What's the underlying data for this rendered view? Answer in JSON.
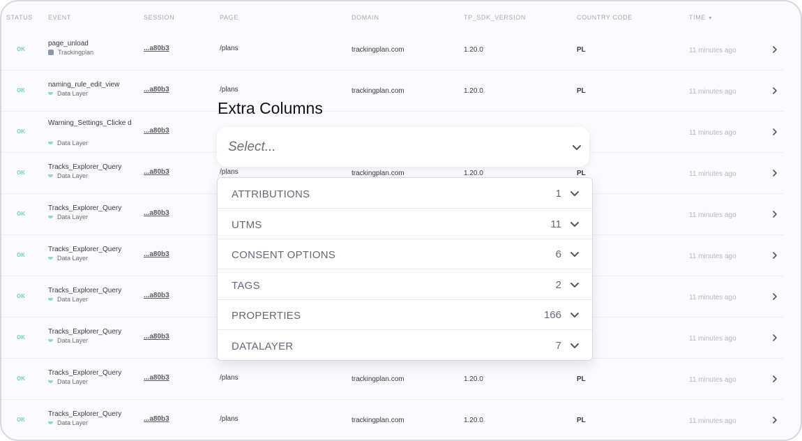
{
  "table": {
    "headers": {
      "status": "STATUS",
      "event": "EVENT",
      "session": "SESSION",
      "page": "PAGE",
      "domain": "DOMAIN",
      "sdk": "TP_SDK_VERSION",
      "country": "COUNTRY CODE",
      "time": "TIME"
    },
    "sort_indicator": "▼",
    "rows": [
      {
        "status": "OK",
        "event": "page_unload",
        "source": "Trackingplan",
        "source_icon": "trackingplan-icon",
        "session": "...a80b3",
        "page": "/plans",
        "domain": "trackingplan.com",
        "sdk": "1.20.0",
        "country": "PL",
        "time": "11 minutes ago"
      },
      {
        "status": "OK",
        "event": "naming_rule_edit_view",
        "source": "Data Layer",
        "source_icon": "datalayer-icon",
        "session": "...a80b3",
        "page": "/plans",
        "domain": "trackingplan.com",
        "sdk": "1.20.0",
        "country": "PL",
        "time": "11 minutes ago"
      },
      {
        "status": "OK",
        "event": "Warning_Settings_Clicke d",
        "source": "Data Layer",
        "source_icon": "datalayer-icon",
        "session": "...a80b3",
        "page": "",
        "domain": "",
        "sdk": "",
        "country": "",
        "time": "11 minutes ago"
      },
      {
        "status": "OK",
        "event": "Tracks_Explorer_Query",
        "source": "Data Layer",
        "source_icon": "datalayer-icon",
        "session": "...a80b3",
        "page": "/plans",
        "domain": "trackingplan.com",
        "sdk": "1.20.0",
        "country": "PL",
        "time": "11 minutes ago"
      },
      {
        "status": "OK",
        "event": "Tracks_Explorer_Query",
        "source": "Data Layer",
        "source_icon": "datalayer-icon",
        "session": "...a80b3",
        "page": "",
        "domain": "",
        "sdk": "",
        "country": "",
        "time": "11 minutes ago"
      },
      {
        "status": "OK",
        "event": "Tracks_Explorer_Query",
        "source": "Data Layer",
        "source_icon": "datalayer-icon",
        "session": "...a80b3",
        "page": "",
        "domain": "",
        "sdk": "",
        "country": "",
        "time": "11 minutes ago"
      },
      {
        "status": "OK",
        "event": "Tracks_Explorer_Query",
        "source": "Data Layer",
        "source_icon": "datalayer-icon",
        "session": "...a80b3",
        "page": "",
        "domain": "",
        "sdk": "",
        "country": "",
        "time": "11 minutes ago"
      },
      {
        "status": "OK",
        "event": "Tracks_Explorer_Query",
        "source": "Data Layer",
        "source_icon": "datalayer-icon",
        "session": "...a80b3",
        "page": "",
        "domain": "",
        "sdk": "",
        "country": "",
        "time": "11 minutes ago"
      },
      {
        "status": "OK",
        "event": "Tracks_Explorer_Query",
        "source": "Data Layer",
        "source_icon": "datalayer-icon",
        "session": "...a80b3",
        "page": "/plans",
        "domain": "trackingplan.com",
        "sdk": "1.20.0",
        "country": "PL",
        "time": "11 minutes ago"
      },
      {
        "status": "OK",
        "event": "Tracks_Explorer_Query",
        "source": "Data Layer",
        "source_icon": "datalayer-icon",
        "session": "...a80b3",
        "page": "/plans",
        "domain": "trackingplan.com",
        "sdk": "1.20.0",
        "country": "PL",
        "time": "11 minutes ago"
      }
    ]
  },
  "extra_columns": {
    "title": "Extra Columns",
    "placeholder": "Select...",
    "groups": [
      {
        "label": "ATTRIBUTIONS",
        "count": "1"
      },
      {
        "label": "UTMS",
        "count": "11"
      },
      {
        "label": "CONSENT OPTIONS",
        "count": "6"
      },
      {
        "label": "TAGS",
        "count": "2"
      },
      {
        "label": "PROPERTIES",
        "count": "166"
      },
      {
        "label": "DATALAYER",
        "count": "7"
      }
    ]
  },
  "colors": {
    "status_ok": "#6fd3c8",
    "datalayer_icon": "#8fdacd",
    "trackingplan_icon": "#8b9aa8"
  }
}
